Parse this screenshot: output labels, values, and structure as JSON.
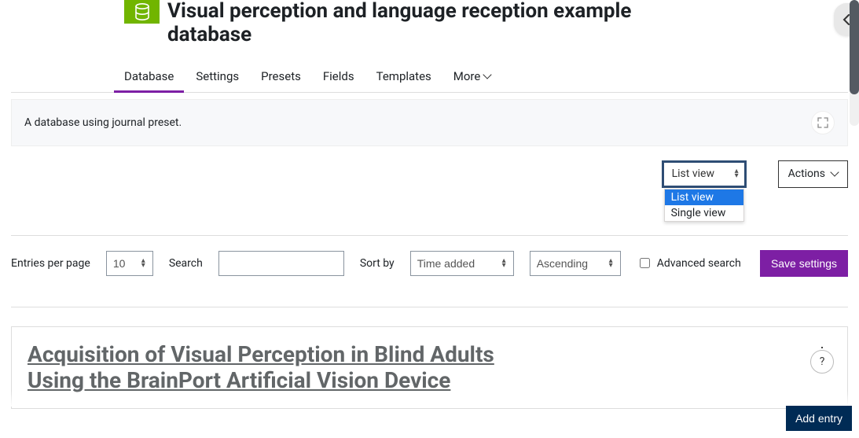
{
  "header": {
    "title": "Visual perception and language reception example database"
  },
  "tabs": {
    "items": [
      "Database",
      "Settings",
      "Presets",
      "Fields",
      "Templates",
      "More"
    ],
    "active": 0
  },
  "description": "A database using journal preset.",
  "view": {
    "current": "List view",
    "options": [
      "List view",
      "Single view"
    ]
  },
  "actions_label": "Actions",
  "filters": {
    "entries_per_page_label": "Entries per page",
    "entries_per_page_value": "10",
    "search_label": "Search",
    "search_value": "",
    "sort_by_label": "Sort by",
    "sort_by_value": "Time added",
    "order_value": "Ascending",
    "advanced_label": "Advanced search",
    "advanced_checked": false,
    "save_label": "Save settings"
  },
  "entry": {
    "title": "Acquisition of Visual Perception in Blind Adults Using the BrainPort Artificial Vision Device"
  },
  "help_label": "?",
  "add_entry_label": "Add entry"
}
